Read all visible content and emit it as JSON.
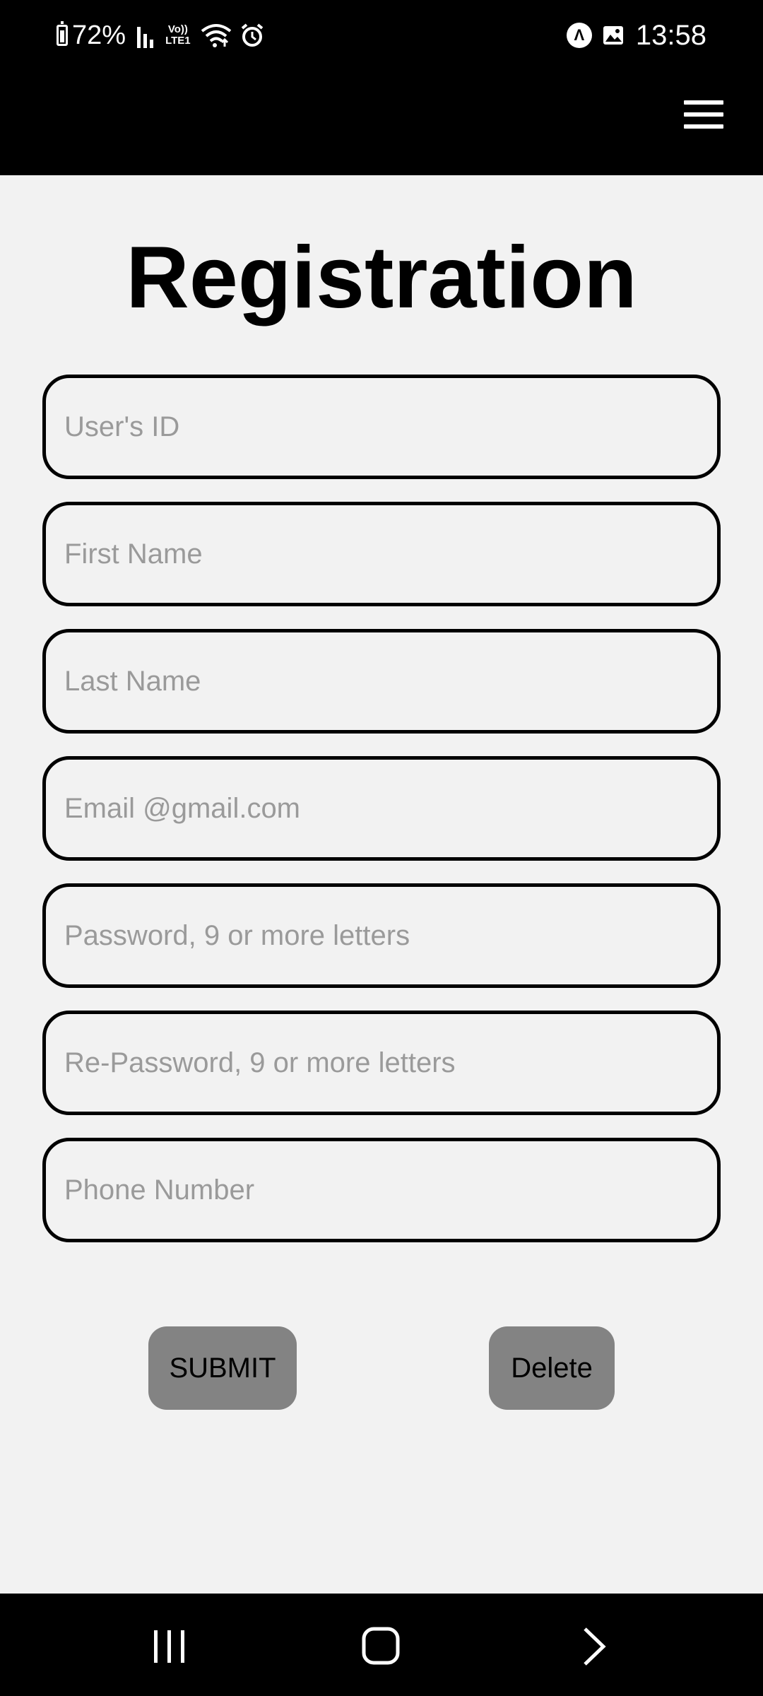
{
  "status_bar": {
    "battery": "72%",
    "network_label_top": "Vo))",
    "network_label_bottom": "LTE1",
    "time": "13:58",
    "icons": [
      "battery-icon",
      "signal-icon",
      "wifi-icon",
      "alarm-icon",
      "app-a-icon",
      "gallery-icon"
    ]
  },
  "app_bar": {
    "menu_icon": "hamburger-menu-icon"
  },
  "form": {
    "title": "Registration",
    "fields": [
      {
        "name": "user-id",
        "placeholder": "User's ID",
        "value": ""
      },
      {
        "name": "first-name",
        "placeholder": "First Name",
        "value": ""
      },
      {
        "name": "last-name",
        "placeholder": "Last Name",
        "value": ""
      },
      {
        "name": "email",
        "placeholder": "Email @gmail.com",
        "value": ""
      },
      {
        "name": "password",
        "placeholder": "Password, 9 or more letters",
        "value": ""
      },
      {
        "name": "re-password",
        "placeholder": "Re-Password, 9 or more letters",
        "value": ""
      },
      {
        "name": "phone",
        "placeholder": "Phone Number",
        "value": ""
      }
    ],
    "submit_label": "SUBMIT",
    "delete_label": "Delete"
  },
  "nav_bar": {
    "icons": [
      "recent-apps-icon",
      "home-icon",
      "back-icon"
    ]
  },
  "colors": {
    "background": "#f2f2f2",
    "bars": "#000000",
    "button": "#838383",
    "placeholder": "#9a9a9a"
  }
}
